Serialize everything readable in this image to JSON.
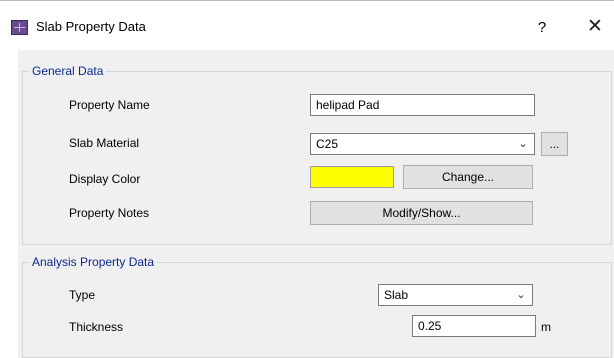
{
  "dialog": {
    "title": "Slab Property Data",
    "help": "?",
    "close": "✕"
  },
  "general": {
    "legend": "General Data",
    "property_name_label": "Property Name",
    "property_name_value": "helipad Pad",
    "slab_material_label": "Slab Material",
    "slab_material_value": "C25",
    "material_more_button": "...",
    "display_color_label": "Display Color",
    "display_color": "#ffff00",
    "change_button": "Change...",
    "property_notes_label": "Property Notes",
    "modify_show_button": "Modify/Show..."
  },
  "analysis": {
    "legend": "Analysis Property Data",
    "type_label": "Type",
    "type_value": "Slab",
    "thickness_label": "Thickness",
    "thickness_value": "0.25",
    "thickness_unit": "m"
  },
  "icons": {
    "app": "structure-grid-icon",
    "chevron": "chevron-down-icon"
  }
}
